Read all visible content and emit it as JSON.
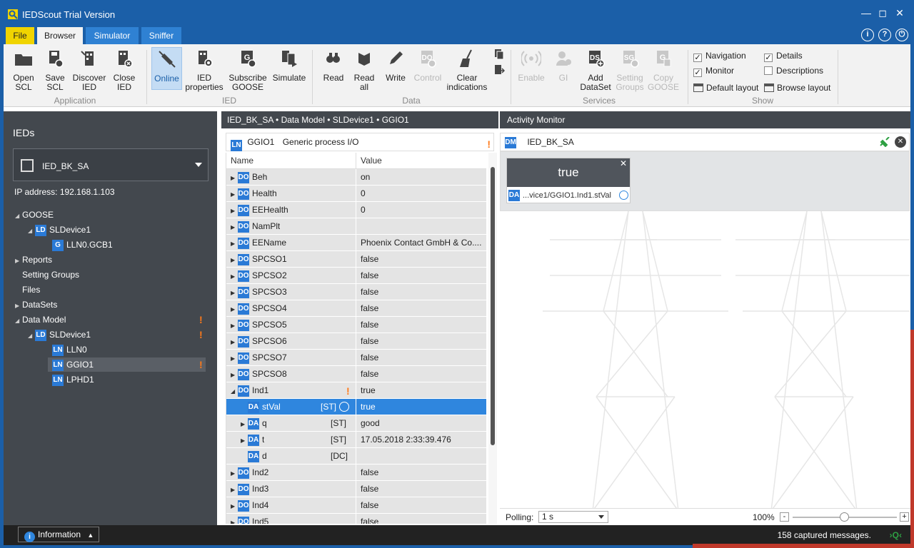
{
  "window": {
    "title": "IEDScout Trial Version"
  },
  "tabs": [
    "File",
    "Browser",
    "Simulator",
    "Sniffer"
  ],
  "ribbon": {
    "application": {
      "label": "Application",
      "buttons": [
        "Open\nSCL",
        "Save\nSCL",
        "Discover\nIED",
        "Close\nIED"
      ]
    },
    "ied": {
      "label": "IED",
      "buttons": [
        "Online",
        "IED\nproperties",
        "Subscribe\nGOOSE",
        "Simulate"
      ]
    },
    "data": {
      "label": "Data",
      "buttons": [
        "Read",
        "Read\nall",
        "Write",
        "Control",
        "Clear\nindications"
      ]
    },
    "services": {
      "label": "Services",
      "buttons": [
        "Enable",
        "GI",
        "Add\nDataSet",
        "Setting\nGroups",
        "Copy\nGOOSE"
      ]
    },
    "show": {
      "label": "Show",
      "navigation": "Navigation",
      "monitor": "Monitor",
      "details": "Details",
      "descriptions": "Descriptions",
      "default_layout": "Default layout",
      "browse_layout": "Browse layout"
    }
  },
  "left": {
    "title": "IEDs",
    "ied_name": "IED_BK_SA",
    "ip": "IP address:  192.168.1.103",
    "tree": {
      "goose": "GOOSE",
      "sldevice1_a": "SLDevice1",
      "gcb": "LLN0.GCB1",
      "reports": "Reports",
      "setting_groups": "Setting Groups",
      "files": "Files",
      "datasets": "DataSets",
      "data_model": "Data Model",
      "sldevice1_b": "SLDevice1",
      "lln0": "LLN0",
      "ggio1": "GGIO1",
      "lphd1": "LPHD1"
    }
  },
  "middle": {
    "breadcrumb": "IED_BK_SA • Data Model • SLDevice1 • GGIO1",
    "ln_name": "GGIO1",
    "ln_desc": "Generic process I/O",
    "col_name": "Name",
    "col_value": "Value",
    "rows": [
      {
        "type": "DO",
        "name": "Beh",
        "value": "on"
      },
      {
        "type": "DO",
        "name": "Health",
        "value": "0"
      },
      {
        "type": "DO",
        "name": "EEHealth",
        "value": "0"
      },
      {
        "type": "DO",
        "name": "NamPlt",
        "value": ""
      },
      {
        "type": "DO",
        "name": "EEName",
        "value": "Phoenix Contact GmbH & Co...."
      },
      {
        "type": "DO",
        "name": "SPCSO1",
        "value": "false"
      },
      {
        "type": "DO",
        "name": "SPCSO2",
        "value": "false"
      },
      {
        "type": "DO",
        "name": "SPCSO3",
        "value": "false"
      },
      {
        "type": "DO",
        "name": "SPCSO4",
        "value": "false"
      },
      {
        "type": "DO",
        "name": "SPCSO5",
        "value": "false"
      },
      {
        "type": "DO",
        "name": "SPCSO6",
        "value": "false"
      },
      {
        "type": "DO",
        "name": "SPCSO7",
        "value": "false"
      },
      {
        "type": "DO",
        "name": "SPCSO8",
        "value": "false"
      },
      {
        "type": "DO",
        "name": "Ind1",
        "value": "true"
      },
      {
        "type": "DA",
        "name": "stVal",
        "fc": "[ST]",
        "value": "true"
      },
      {
        "type": "DA",
        "name": "q",
        "fc": "[ST]",
        "value": "good"
      },
      {
        "type": "DA",
        "name": "t",
        "fc": "[ST]",
        "value": "17.05.2018 2:33:39.476"
      },
      {
        "type": "DA",
        "name": "d",
        "fc": "[DC]",
        "value": ""
      },
      {
        "type": "DO",
        "name": "Ind2",
        "value": "false"
      },
      {
        "type": "DO",
        "name": "Ind3",
        "value": "false"
      },
      {
        "type": "DO",
        "name": "Ind4",
        "value": "false"
      },
      {
        "type": "DO",
        "name": "Ind5",
        "value": "false"
      }
    ]
  },
  "right": {
    "title": "Activity Monitor",
    "ied_name": "IED_BK_SA",
    "card_value": "true",
    "card_path": "...vice1/GGIO1.Ind1.stVal",
    "polling_label": "Polling:",
    "polling_value": "1 s",
    "zoom": "100%"
  },
  "status": {
    "info": "Information",
    "captured": "158 captured messages."
  },
  "colors": {
    "accent": "#1b5fa8",
    "tab_file": "#f0d400",
    "selection": "#2f86de",
    "warning": "#ff7a1a"
  }
}
